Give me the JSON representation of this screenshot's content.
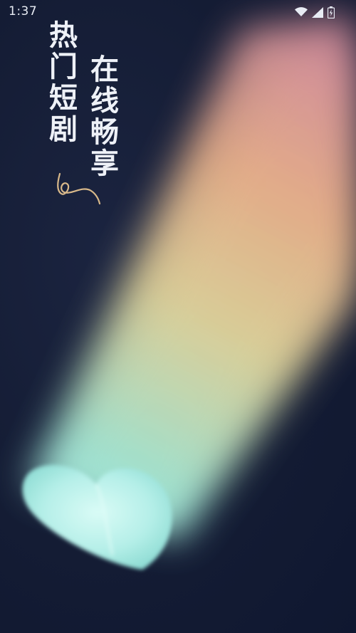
{
  "status_bar": {
    "time": "1:37",
    "icons": [
      "wifi-icon",
      "signal-icon",
      "battery-icon"
    ]
  },
  "splash": {
    "slogan_left": "热门短剧",
    "slogan_right": "在线畅享",
    "colors": {
      "background": "#141c34",
      "text": "#eef1f7",
      "beam_pink": "#e79aa6",
      "beam_peach": "#f3b88f",
      "beam_yellow": "#e9dca0",
      "beam_mint": "#a6ead6",
      "heart": "#a9ece4",
      "swirl": "#d9b98a"
    }
  }
}
